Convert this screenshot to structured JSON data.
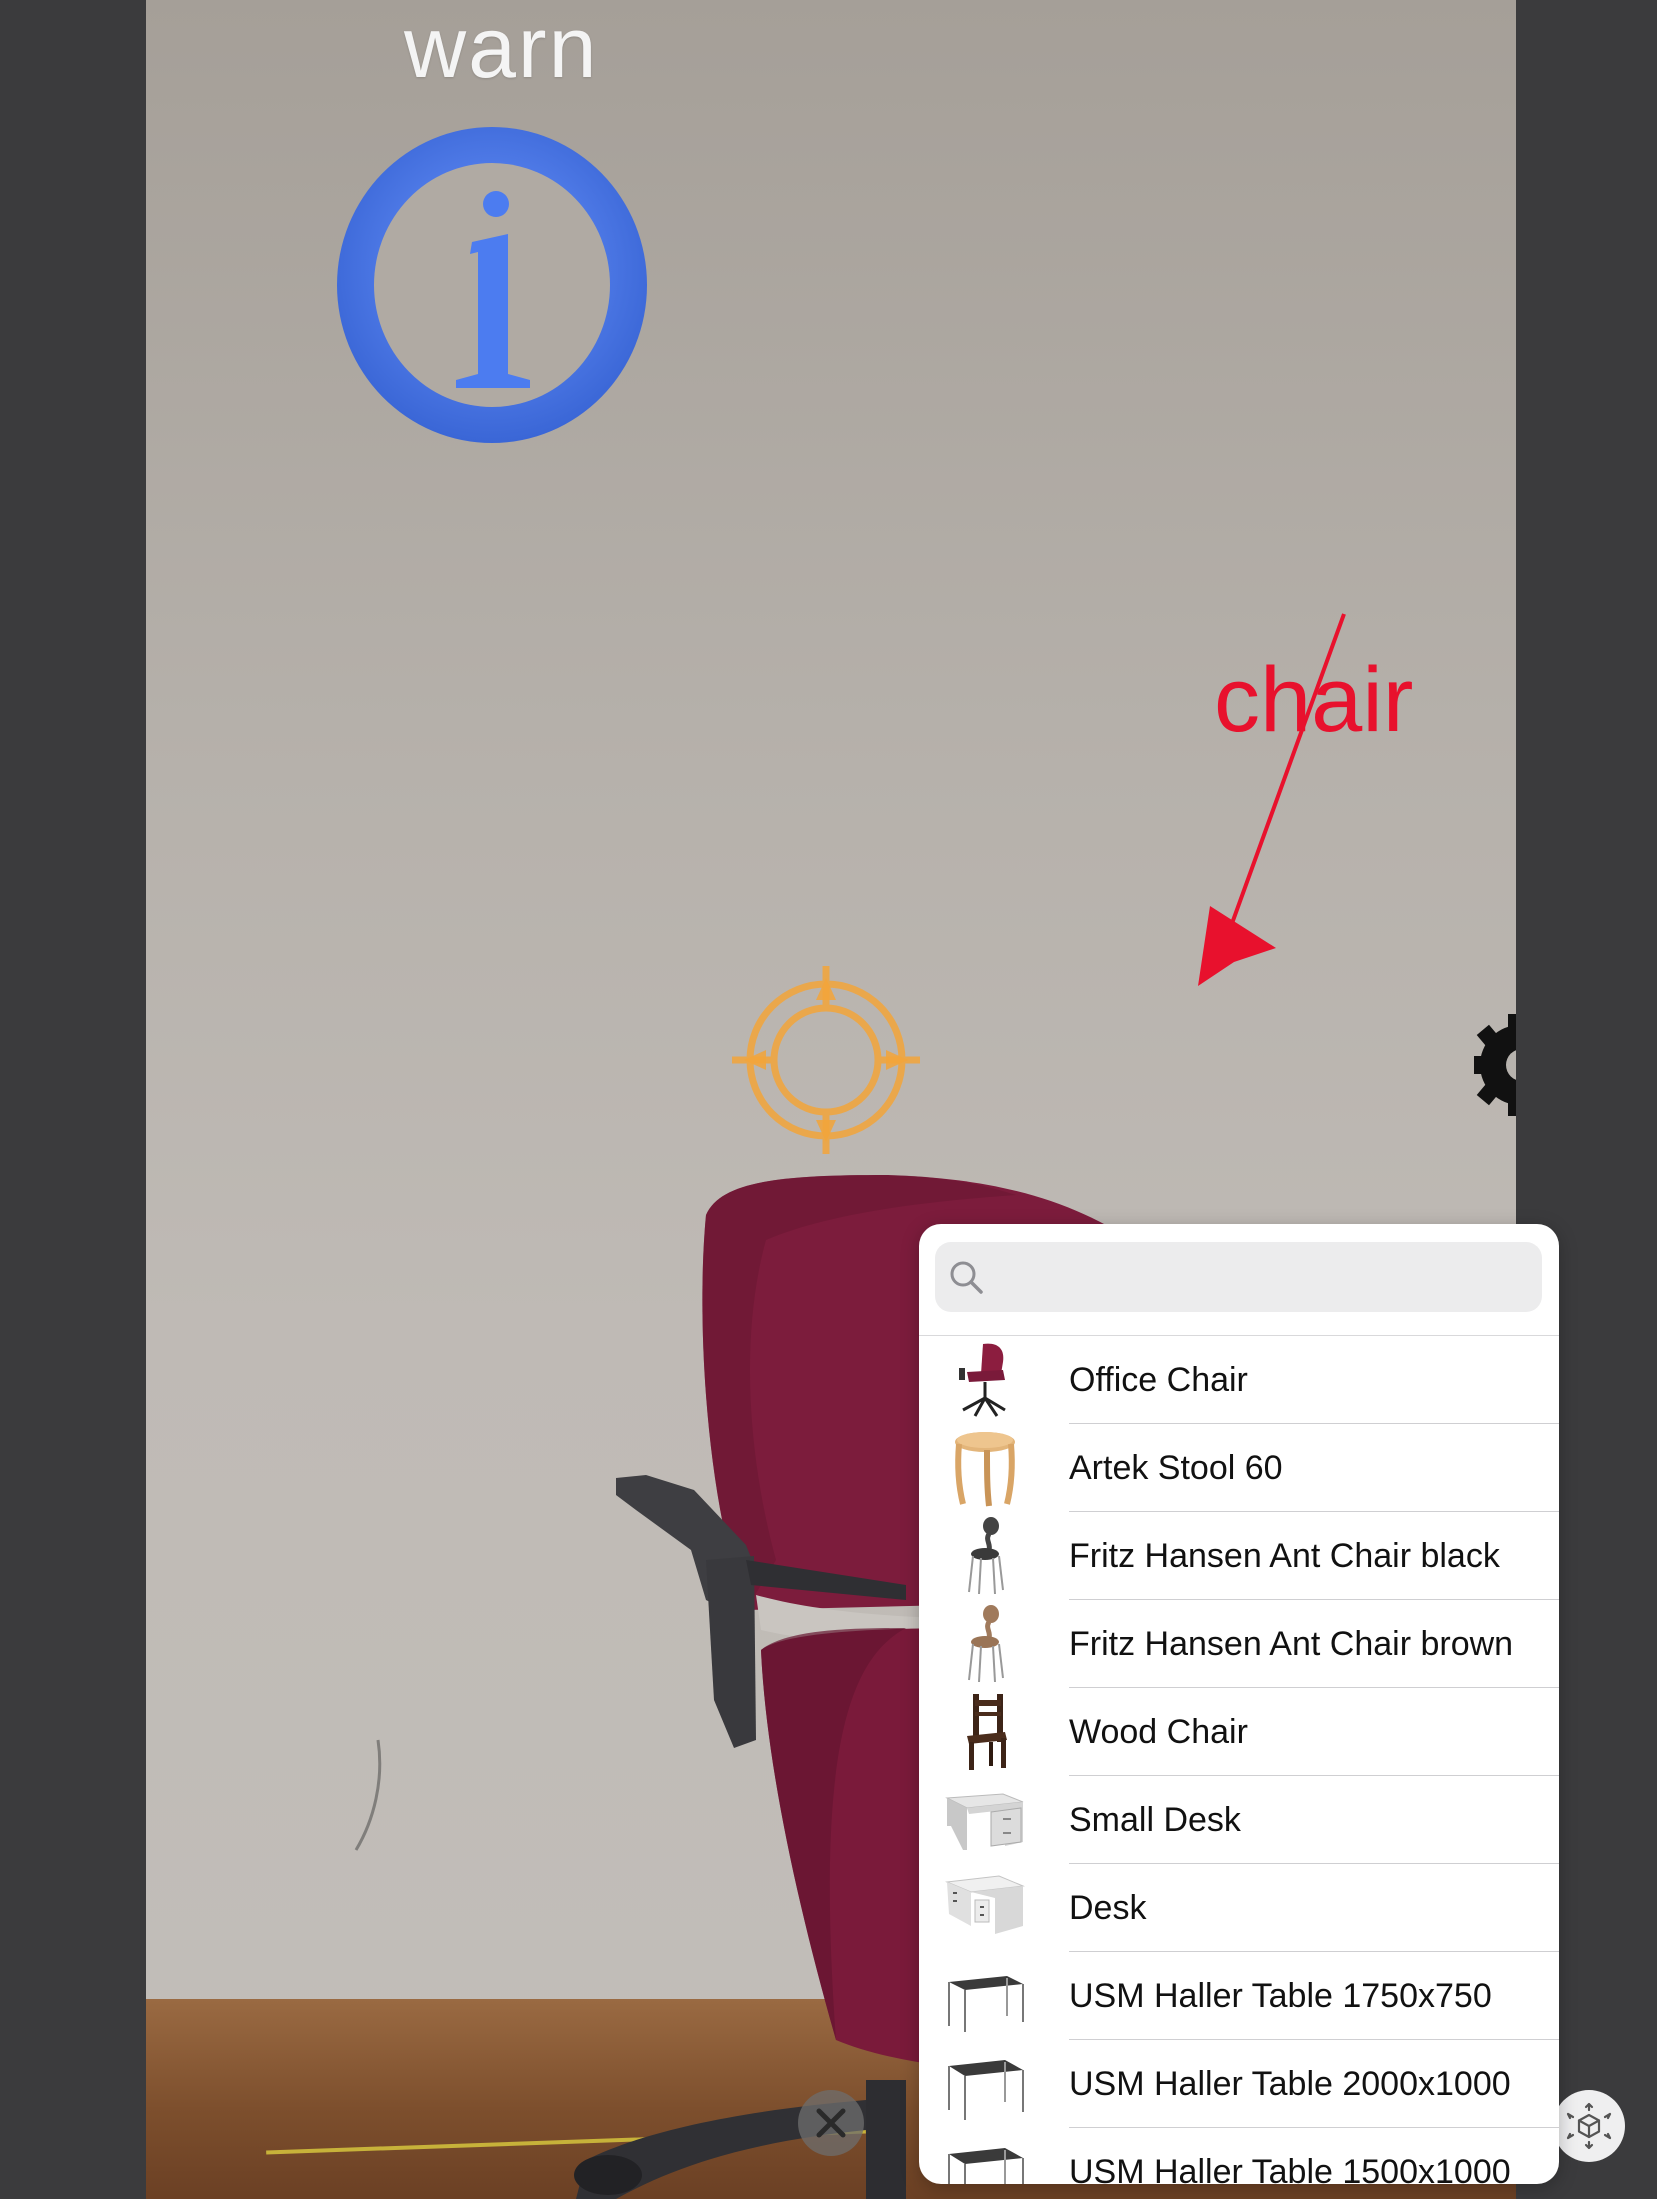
{
  "ar_scene": {
    "warn_label": "warn",
    "chair_label": "chair",
    "icons": {
      "info": "info-icon",
      "arrow": "arrow-pointer-icon",
      "target": "target-reticle-icon",
      "gear": "gear-icon"
    },
    "colors": {
      "info_blue": "#4c7cf0",
      "chair_red": "#e8112d",
      "reticle_orange": "#f3a53a",
      "office_chair": "#7c1c3c"
    }
  },
  "controls": {
    "close_icon": "close-icon",
    "ar_icon": "ar-cube-icon"
  },
  "popover": {
    "search": {
      "placeholder": "",
      "value": ""
    },
    "items": [
      {
        "label": "Office Chair",
        "thumb": "office-chair-thumb"
      },
      {
        "label": "Artek Stool 60",
        "thumb": "stool-thumb"
      },
      {
        "label": "Fritz Hansen Ant Chair black",
        "thumb": "ant-chair-black-thumb"
      },
      {
        "label": "Fritz Hansen Ant Chair brown",
        "thumb": "ant-chair-brown-thumb"
      },
      {
        "label": "Wood Chair",
        "thumb": "wood-chair-thumb"
      },
      {
        "label": "Small Desk",
        "thumb": "small-desk-thumb"
      },
      {
        "label": "Desk",
        "thumb": "desk-thumb"
      },
      {
        "label": "USM Haller Table 1750x750",
        "thumb": "table-thumb"
      },
      {
        "label": "USM Haller Table 2000x1000",
        "thumb": "table-thumb"
      },
      {
        "label": "USM Haller Table 1500x1000",
        "thumb": "table-thumb"
      }
    ]
  }
}
